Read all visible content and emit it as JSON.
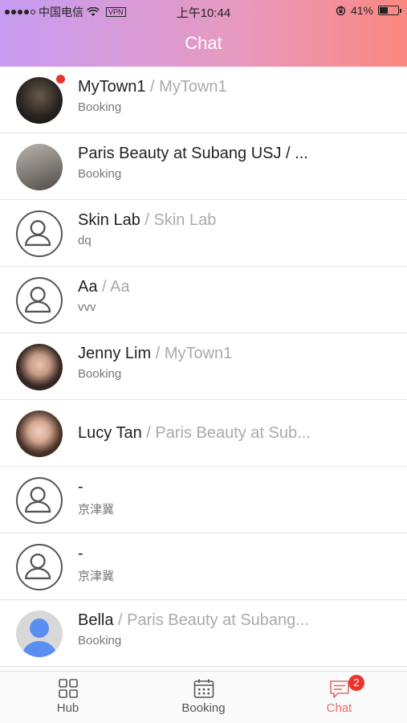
{
  "status_bar": {
    "carrier": "中国电信",
    "vpn": "VPN",
    "time": "上午10:44",
    "battery": "41%",
    "battery_level": 0.41
  },
  "header": {
    "title": "Chat"
  },
  "chats": [
    {
      "name": "MyTown1",
      "separator": " / ",
      "shop": "MyTown1",
      "subtitle": "Booking",
      "unread": true
    },
    {
      "name": "Paris Beauty at Subang USJ",
      "separator": " / ",
      "shop": "...",
      "subtitle": "Booking"
    },
    {
      "name": "Skin Lab",
      "separator": " / ",
      "shop": "Skin Lab",
      "subtitle": "dq"
    },
    {
      "name": "Aa",
      "separator": " / ",
      "shop": "Aa",
      "subtitle": "vvv"
    },
    {
      "name": "Jenny Lim",
      "separator": " / ",
      "shop": "MyTown1",
      "subtitle": "Booking"
    },
    {
      "name": "Lucy Tan",
      "separator": " / ",
      "shop": "Paris Beauty at Sub...",
      "subtitle": ""
    },
    {
      "name": "-",
      "separator": "",
      "shop": "",
      "subtitle": "京津冀"
    },
    {
      "name": "-",
      "separator": "",
      "shop": "",
      "subtitle": "京津冀"
    },
    {
      "name": "Bella",
      "separator": " / ",
      "shop": "Paris Beauty at Subang...",
      "subtitle": "Booking"
    }
  ],
  "tabbar": {
    "hub": "Hub",
    "booking": "Booking",
    "chat": "Chat",
    "chat_badge": "2",
    "active_color": "#e56b6b"
  },
  "colors": {
    "header_gradient_start": "#c79cf3",
    "header_gradient_end": "#fb8880",
    "badge": "#e8362c"
  }
}
